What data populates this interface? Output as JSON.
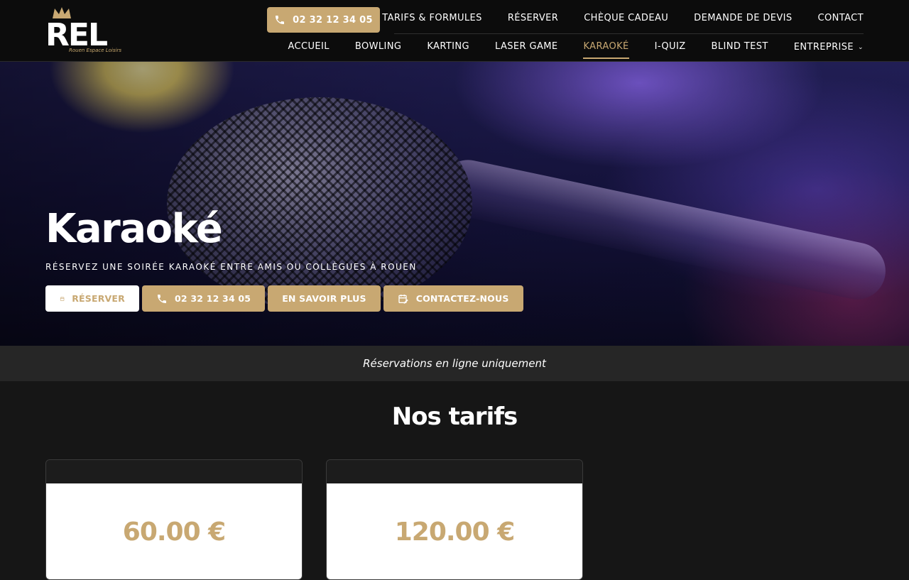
{
  "header": {
    "logo_text": "REL",
    "logo_subtitle": "Rouen Espace Loisirs",
    "phone_button": "02 32 12 34 05",
    "top_nav": [
      "TARIFS & FORMULES",
      "RÉSERVER",
      "CHÈQUE CADEAU",
      "DEMANDE DE DEVIS",
      "CONTACT"
    ],
    "main_nav": [
      "ACCUEIL",
      "BOWLING",
      "KARTING",
      "LASER GAME",
      "KARAOKÉ",
      "I-QUIZ",
      "BLIND TEST",
      "ENTREPRISE"
    ],
    "active_item": "KARAOKÉ"
  },
  "hero": {
    "title": "Karaoké",
    "subtitle": "RÉSERVEZ UNE SOIRÉE KARAOKÉ ENTRE AMIS OU COLLÈGUES À ROUEN",
    "buttons": {
      "reserve": "RÉSERVER",
      "phone": "02 32 12 34 05",
      "learn_more": "EN SAVOIR PLUS",
      "contact": "CONTACTEZ-NOUS"
    }
  },
  "notice": "Réservations en ligne uniquement",
  "tarifs": {
    "title": "Nos tarifs",
    "cards": [
      {
        "price": "60.00 €"
      },
      {
        "price": "120.00 €"
      }
    ]
  },
  "colors": {
    "accent": "#c8a872",
    "background": "#161616",
    "header": "#0c0c0c"
  }
}
